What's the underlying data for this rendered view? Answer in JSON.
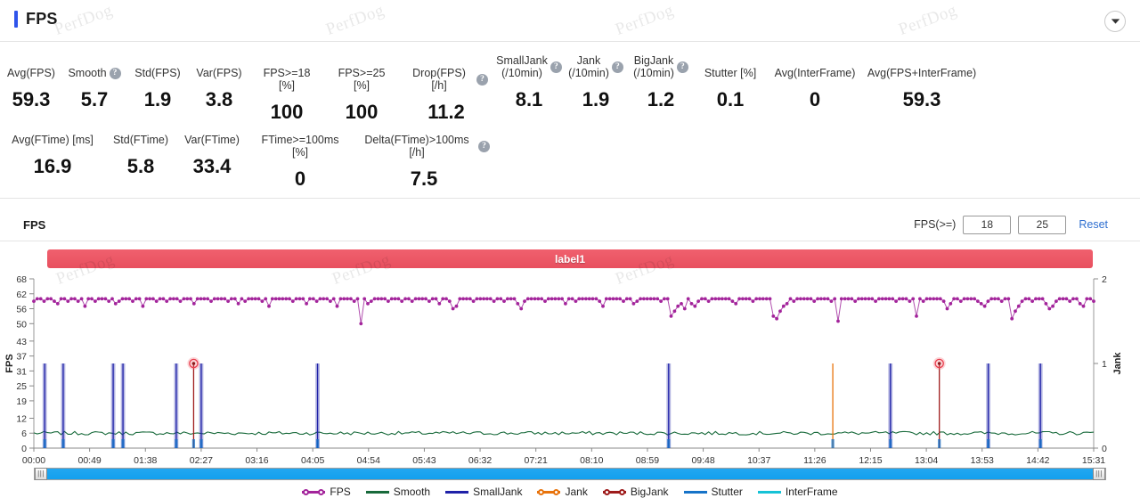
{
  "header": {
    "title": "FPS",
    "accent_color": "#2f54eb",
    "collapse_icon": "chevron-down-icon"
  },
  "watermark": {
    "text": "PerfDog"
  },
  "stats": {
    "row1": [
      {
        "label": "Avg(FPS)",
        "value": "59.3",
        "help": false
      },
      {
        "label": "Smooth",
        "value": "5.7",
        "help": true
      },
      {
        "label": "Std(FPS)",
        "value": "1.9",
        "help": false
      },
      {
        "label": "Var(FPS)",
        "value": "3.8",
        "help": false
      },
      {
        "label": "FPS>=18 [%]",
        "value": "100",
        "help": false
      },
      {
        "label": "FPS>=25 [%]",
        "value": "100",
        "help": false
      },
      {
        "label": "Drop(FPS) [/h]",
        "value": "11.2",
        "help": true
      },
      {
        "label": "SmallJank\n(/10min)",
        "value": "8.1",
        "help": true
      },
      {
        "label": "Jank\n(/10min)",
        "value": "1.9",
        "help": true
      },
      {
        "label": "BigJank\n(/10min)",
        "value": "1.2",
        "help": true
      },
      {
        "label": "Stutter [%]",
        "value": "0.1",
        "help": false
      },
      {
        "label": "Avg(InterFrame)",
        "value": "0",
        "help": false
      },
      {
        "label": "Avg(FPS+InterFrame)",
        "value": "59.3",
        "help": false
      }
    ],
    "row2": [
      {
        "label": "Avg(FTime) [ms]",
        "value": "16.9",
        "help": false
      },
      {
        "label": "Std(FTime)",
        "value": "5.8",
        "help": false
      },
      {
        "label": "Var(FTime)",
        "value": "33.4",
        "help": false
      },
      {
        "label": "FTime>=100ms [%]",
        "value": "0",
        "help": false
      },
      {
        "label": "Delta(FTime)>100ms [/h]",
        "value": "7.5",
        "help": true
      }
    ]
  },
  "chart_header": {
    "title": "FPS",
    "threshold_label": "FPS(>=)",
    "threshold_1": "18",
    "threshold_2": "25",
    "threshold_placeholder": "18",
    "reset_label": "Reset"
  },
  "label_bar": {
    "text": "label1",
    "color": "#ec5565"
  },
  "scrollbar": {
    "left_handle_icon": "drag-handle-icon",
    "right_handle_icon": "drag-handle-icon",
    "track_color": "#1ba4ee"
  },
  "legend": [
    {
      "name": "FPS",
      "color": "#a3249b",
      "style": "line-dot"
    },
    {
      "name": "Smooth",
      "color": "#186a3b",
      "style": "line"
    },
    {
      "name": "SmallJank",
      "color": "#1f21a8",
      "style": "line"
    },
    {
      "name": "Jank",
      "color": "#e8730c",
      "style": "line-dot"
    },
    {
      "name": "BigJank",
      "color": "#9e1b1b",
      "style": "line-dot"
    },
    {
      "name": "Stutter",
      "color": "#1673c8",
      "style": "line"
    },
    {
      "name": "InterFrame",
      "color": "#15c2d6",
      "style": "line"
    }
  ],
  "chart_data": {
    "type": "line",
    "title": "FPS",
    "xlabel": "",
    "ylabel": "FPS",
    "y2label": "Jank",
    "grid": false,
    "legend_position": "bottom",
    "ylim": [
      0,
      68
    ],
    "y2lim": [
      0,
      2
    ],
    "yticks": [
      0,
      6,
      12,
      19,
      25,
      31,
      37,
      43,
      50,
      56,
      62,
      68
    ],
    "y2ticks": [
      0,
      1,
      2
    ],
    "xticks": [
      "00:00",
      "00:49",
      "01:38",
      "02:27",
      "03:16",
      "04:05",
      "04:54",
      "05:43",
      "06:32",
      "07:21",
      "08:10",
      "08:59",
      "09:48",
      "10:37",
      "11:26",
      "12:15",
      "13:04",
      "13:53",
      "14:42",
      "15:31"
    ],
    "x_range_seconds": [
      0,
      975
    ],
    "series": [
      {
        "name": "FPS",
        "color": "#a3249b",
        "axis": "left",
        "marker": "circle",
        "values": [
          59,
          60,
          60,
          59,
          60,
          60,
          59,
          58,
          60,
          60,
          59,
          60,
          60,
          59,
          60,
          57,
          60,
          60,
          59,
          60,
          60,
          60,
          59,
          60,
          58,
          59,
          60,
          60,
          60,
          59,
          60,
          60,
          57,
          60,
          60,
          60,
          59,
          60,
          60,
          59,
          60,
          60,
          60,
          59,
          60,
          60,
          60,
          58,
          60,
          60,
          60,
          60,
          59,
          60,
          60,
          60,
          60,
          59,
          60,
          60,
          58,
          60,
          59,
          60,
          60,
          60,
          60,
          59,
          60,
          57,
          60,
          60,
          60,
          60,
          60,
          60,
          59,
          60,
          60,
          60,
          58,
          60,
          60,
          59,
          60,
          60,
          60,
          59,
          60,
          57,
          60,
          60,
          60,
          60,
          59,
          60,
          50,
          60,
          58,
          59,
          60,
          60,
          60,
          60,
          59,
          60,
          60,
          60,
          59,
          60,
          60,
          59,
          60,
          60,
          60,
          60,
          59,
          60,
          60,
          58,
          60,
          60,
          59,
          56,
          57,
          60,
          60,
          60,
          60,
          59,
          60,
          60,
          60,
          60,
          60,
          59,
          60,
          60,
          59,
          60,
          60,
          60,
          58,
          56,
          59,
          60,
          60,
          60,
          60,
          60,
          59,
          60,
          60,
          60,
          60,
          60,
          58,
          60,
          60,
          59,
          60,
          60,
          60,
          60,
          60,
          60,
          59,
          57,
          60,
          60,
          60,
          60,
          60,
          59,
          60,
          60,
          58,
          59,
          60,
          60,
          60,
          60,
          60,
          60,
          59,
          60,
          60,
          53,
          55,
          57,
          58,
          56,
          60,
          58,
          57,
          59,
          60,
          60,
          59,
          60,
          60,
          60,
          60,
          60,
          60,
          59,
          58,
          60,
          60,
          60,
          60,
          59,
          60,
          60,
          60,
          60,
          60,
          53,
          52,
          55,
          57,
          58,
          60,
          59,
          60,
          60,
          60,
          60,
          60,
          59,
          60,
          60,
          60,
          60,
          59,
          60,
          51,
          60,
          60,
          60,
          60,
          59,
          60,
          60,
          60,
          60,
          60,
          59,
          60,
          60,
          60,
          60,
          60,
          59,
          60,
          60,
          60,
          59,
          60,
          53,
          60,
          59,
          60,
          60,
          60,
          60,
          60,
          59,
          56,
          58,
          60,
          60,
          59,
          60,
          60,
          60,
          60,
          59,
          58,
          57,
          59,
          60,
          60,
          60,
          59,
          60,
          60,
          52,
          55,
          57,
          59,
          60,
          60,
          59,
          60,
          60,
          60,
          58,
          56,
          57,
          59,
          60,
          60,
          60,
          59,
          60,
          60,
          58,
          57,
          60,
          60,
          59
        ]
      },
      {
        "name": "Smooth",
        "color": "#186a3b",
        "axis": "left",
        "baseline": 6,
        "note": "near-flat line around 6 with small noise"
      },
      {
        "name": "SmallJank",
        "color": "#1f21a8",
        "axis": "right",
        "spikes_at": [
          "00:10",
          "00:27",
          "01:13",
          "01:22",
          "02:11",
          "02:34",
          "04:21",
          "09:44",
          "13:08",
          "14:38",
          "15:26"
        ],
        "spike_value": 1
      },
      {
        "name": "Jank",
        "color": "#e8730c",
        "axis": "right",
        "spikes_at": [
          "12:15"
        ],
        "spike_value": 1
      },
      {
        "name": "BigJank",
        "color": "#9e1b1b",
        "axis": "right",
        "spikes_at": [
          "02:27",
          "13:53"
        ],
        "spike_value": 1,
        "highlighted": [
          "02:27",
          "13:53"
        ]
      },
      {
        "name": "Stutter",
        "color": "#1673c8",
        "axis": "left",
        "note": "small blips at bottom aligned with jank spikes"
      },
      {
        "name": "InterFrame",
        "color": "#15c2d6",
        "axis": "left",
        "values": []
      }
    ]
  }
}
